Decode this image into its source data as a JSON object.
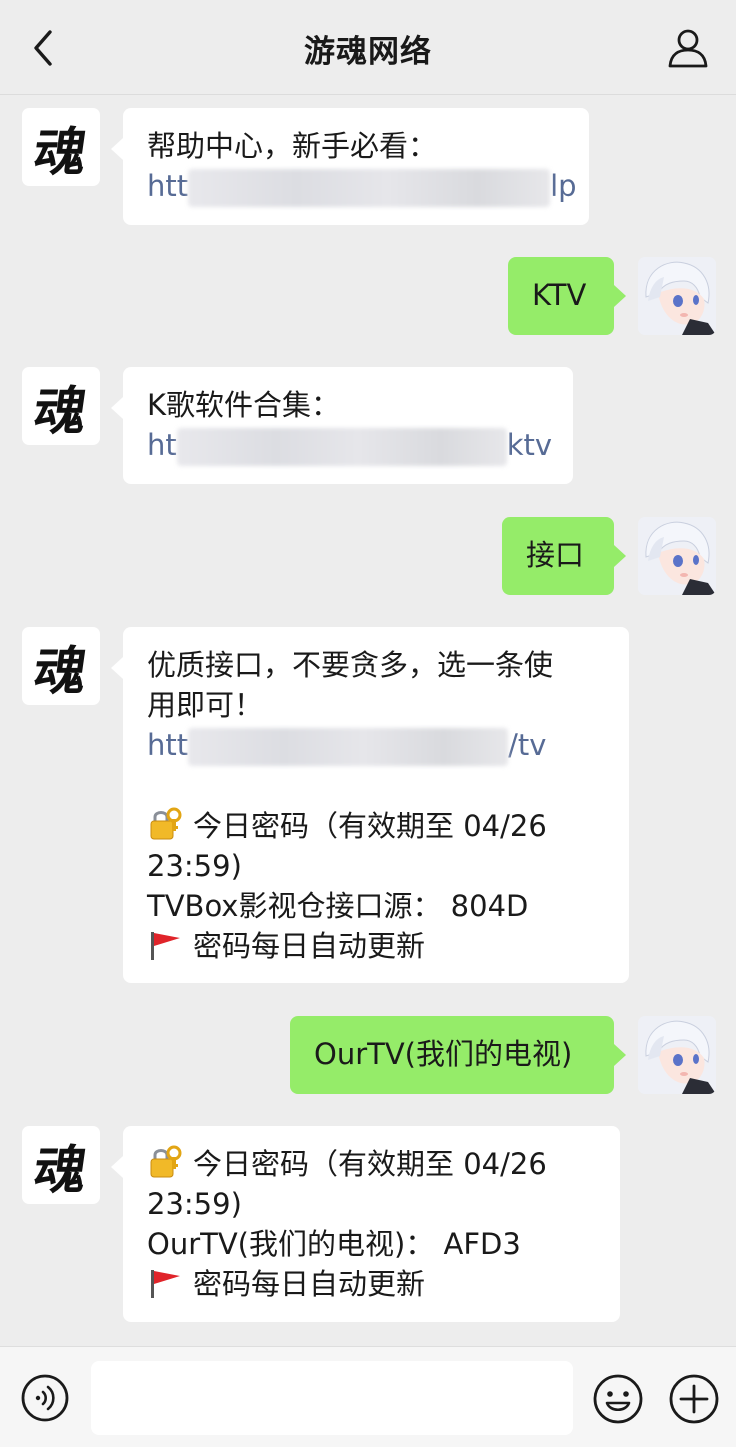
{
  "header": {
    "title": "游魂网络"
  },
  "bot": {
    "avatar_glyph": "魂"
  },
  "messages": [
    {
      "from": "bot",
      "lines": [
        "帮助中心，新手必看："
      ],
      "link_prefix": "htt",
      "link_suffix": "lp"
    },
    {
      "from": "me",
      "text": "KTV"
    },
    {
      "from": "bot",
      "lines": [
        "K歌软件合集："
      ],
      "link_prefix": "ht",
      "link_suffix": "ktv"
    },
    {
      "from": "me",
      "text": "接口"
    },
    {
      "from": "bot",
      "lines": [
        "优质接口，不要贪多，选一条使",
        "用即可！"
      ],
      "link_prefix": "htt",
      "link_suffix": "/tv",
      "password_line1": "今日密码（有效期至 04/26",
      "password_line2": "23:59)",
      "source_line": "TVBox影视仓接口源：  804D",
      "note_line": "密码每日自动更新"
    },
    {
      "from": "me",
      "text": "OurTV(我们的电视)"
    },
    {
      "from": "bot",
      "password_line1": "今日密码（有效期至 04/26",
      "password_line2": "23:59)",
      "source_line": "OurTV(我们的电视)：  AFD3",
      "note_line": "密码每日自动更新"
    }
  ],
  "icons": {
    "back": "chevron-left-icon",
    "profile": "person-icon",
    "voice": "voice-icon",
    "emoji": "smiley-icon",
    "more": "plus-icon",
    "lock": "lock-key-icon",
    "flag": "red-flag-icon"
  },
  "colors": {
    "background": "#ededed",
    "bubble_me": "#95ec69",
    "bubble_other": "#ffffff",
    "link": "#576b95"
  },
  "input": {
    "value": "",
    "placeholder": ""
  }
}
